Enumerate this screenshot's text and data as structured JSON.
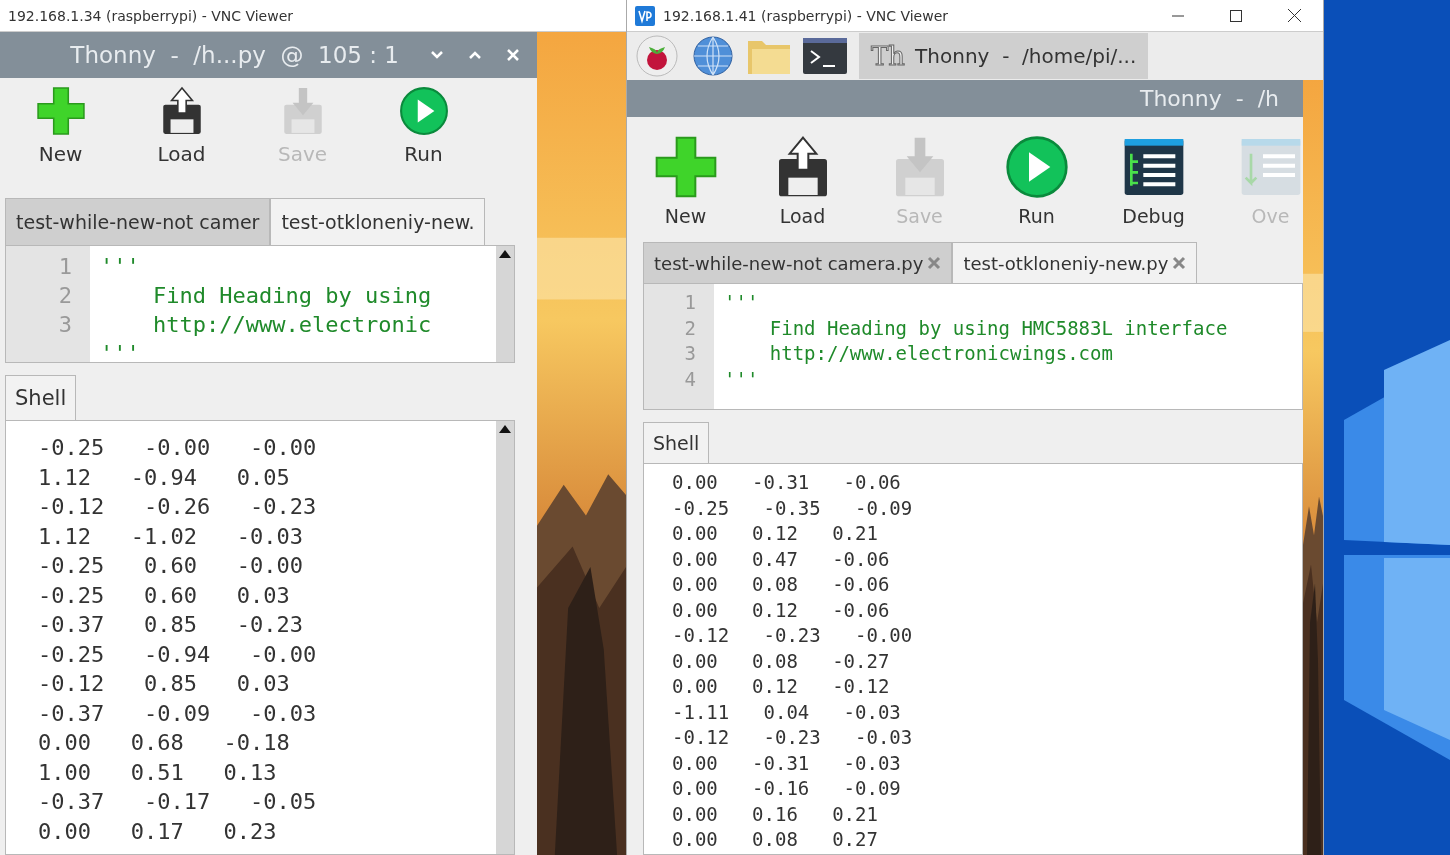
{
  "windows": [
    {
      "title": "192.168.1.34 (raspberrypi) - VNC Viewer",
      "thonny": {
        "title": "Thonny  -  /h...py  @  105 : 1",
        "title_buttons": [
          {
            "kind": "down"
          },
          {
            "kind": "up"
          },
          {
            "kind": "close"
          }
        ],
        "toolbar": [
          {
            "kind": "new",
            "label": "New",
            "disabled": false
          },
          {
            "kind": "load",
            "label": "Load",
            "disabled": false
          },
          {
            "kind": "save",
            "label": "Save",
            "disabled": true
          },
          {
            "kind": "run",
            "label": "Run",
            "disabled": false
          }
        ],
        "tabs": [
          {
            "label": "test-while-new-not camer",
            "selected": false,
            "closable": false
          },
          {
            "label": "test-otkloneniy-new.",
            "selected": true,
            "closable": false
          }
        ],
        "editor_lines": [
          {
            "number": "1",
            "code": "'''"
          },
          {
            "number": "2",
            "code": "    Find Heading by using"
          },
          {
            "number": "3",
            "code": "    http://www.electronic"
          },
          {
            "code": "'''"
          }
        ],
        "shell_tab": "Shell",
        "shell_lines": [
          "-0.25   -0.00   -0.00",
          "1.12   -0.94   0.05",
          "-0.12   -0.26   -0.23",
          "1.12   -1.02   -0.03",
          "-0.25   0.60   -0.00",
          "-0.25   0.60   0.03",
          "-0.37   0.85   -0.23",
          "-0.25   -0.94   -0.00",
          "-0.12   0.85   0.03",
          "-0.37   -0.09   -0.03",
          "0.00   0.68   -0.18",
          "1.00   0.51   0.13",
          "-0.37   -0.17   -0.05",
          "0.00   0.17   0.23"
        ]
      }
    },
    {
      "title": "192.168.1.41 (raspberrypi) - VNC Viewer",
      "window_buttons": [
        {
          "kind": "minimize"
        },
        {
          "kind": "maximize"
        },
        {
          "kind": "close"
        }
      ],
      "taskbar": {
        "launchers": [
          {
            "kind": "raspberry"
          },
          {
            "kind": "globe"
          },
          {
            "kind": "folder"
          },
          {
            "kind": "terminal"
          }
        ],
        "task": {
          "icon_text": "Th",
          "label": "Thonny  -  /home/pi/..."
        }
      },
      "thonny": {
        "title": "Thonny  -  /h",
        "toolbar": [
          {
            "kind": "new",
            "label": "New",
            "disabled": false
          },
          {
            "kind": "load",
            "label": "Load",
            "disabled": false
          },
          {
            "kind": "save",
            "label": "Save",
            "disabled": true
          },
          {
            "kind": "run",
            "label": "Run",
            "disabled": false
          },
          {
            "kind": "debug",
            "label": "Debug",
            "disabled": false
          },
          {
            "kind": "over",
            "label": "Ove",
            "disabled": true
          }
        ],
        "tabs": [
          {
            "label": "test-while-new-not camera.py",
            "selected": false,
            "closable": true
          },
          {
            "label": "test-otkloneniy-new.py",
            "selected": true,
            "closable": true
          }
        ],
        "editor_lines": [
          {
            "number": "1",
            "code": "'''"
          },
          {
            "number": "2",
            "code": "    Find Heading by using HMC5883L interface"
          },
          {
            "number": "3",
            "code": "    http://www.electronicwings.com"
          },
          {
            "number": "4",
            "code": "'''"
          }
        ],
        "shell_tab": "Shell",
        "shell_lines": [
          "0.00   -0.31   -0.06",
          "-0.25   -0.35   -0.09",
          "0.00   0.12   0.21",
          "0.00   0.47   -0.06",
          "0.00   0.08   -0.06",
          "0.00   0.12   -0.06",
          "-0.12   -0.23   -0.00",
          "0.00   0.08   -0.27",
          "0.00   0.12   -0.12",
          "-1.11   0.04   -0.03",
          "-0.12   -0.23   -0.03",
          "0.00   -0.31   -0.03",
          "0.00   -0.16   -0.09",
          "0.00   0.16   0.21",
          "0.00   0.08   0.27"
        ]
      }
    }
  ]
}
